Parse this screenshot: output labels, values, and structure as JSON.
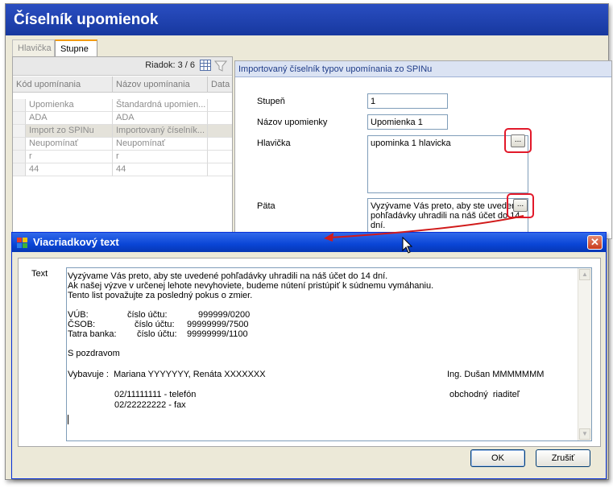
{
  "app": {
    "title": "Číselník  upomienok"
  },
  "tabs": [
    {
      "label": "Hlavička"
    },
    {
      "label": "Stupne"
    }
  ],
  "grid": {
    "row_counter": "Riadok: 3 / 6",
    "columns": [
      "Kód upomínania",
      "Názov upomínania",
      "Data"
    ],
    "rows": [
      [
        "Upomienka",
        "Štandardná  upomien..."
      ],
      [
        "ADA",
        "ADA"
      ],
      [
        "Import zo SPINu",
        "Importovaný  číselník..."
      ],
      [
        "Neupomínať",
        "Neupomínať"
      ],
      [
        "r",
        "r"
      ],
      [
        "44",
        "44"
      ]
    ],
    "selected_row": 2
  },
  "detail": {
    "header": "Importovaný číselník typov upomínania zo SPINu",
    "fields": {
      "stupen_label": "Stupeň",
      "stupen_value": "1",
      "nazov_label": "Názov upomienky",
      "nazov_value": "Upomienka 1",
      "hlavicka_label": "Hlavička",
      "hlavicka_value": "upominka 1 hlavicka",
      "pata_label": "Päta",
      "pata_line1": "Vyzývame Vás preto, aby ste uvedené",
      "pata_line2": "pohľadávky uhradili na náš účet do 14",
      "pata_line3": "dní."
    },
    "ellipsis_label": "..."
  },
  "dialog": {
    "title": "Viacriadkový text",
    "text_label": "Text",
    "lines": {
      "l1": "Vyzývame Vás preto, aby ste uvedené pohľadávky uhradili na náš účet do 14 dní.",
      "l2": "Ak našej výzve v určenej lehote nevyhoviete, budeme nútení pristúpiť k súdnemu vymáhaniu.",
      "l3": "Tento list považujte za posledný pokus o zmier.",
      "bank1_name": "VÚB:",
      "bank1_label": "číslo účtu:",
      "bank1_account": "999999/0200",
      "bank2_name": "ČSOB:",
      "bank2_label": "číslo účtu:",
      "bank2_account": "99999999/7500",
      "bank3_name": "Tatra banka:",
      "bank3_label": "číslo účtu:",
      "bank3_account": "99999999/1100",
      "greeting": "S pozdravom",
      "vybavuje": "Vybavuje :  Mariana YYYYYYY, Renáta XXXXXXX",
      "signatory": "Ing. Dušan MMMMMMM",
      "phone": "02/11111111 - telefón",
      "fax": "02/22222222 - fax",
      "position": "obchodný  riaditeľ"
    },
    "ok_label": "OK",
    "cancel_label": "Zrušiť"
  },
  "colors": {
    "title_bar": "#1e3fad",
    "dialog_title_bar": "#0a45d6",
    "highlight_red": "#e2192a"
  }
}
